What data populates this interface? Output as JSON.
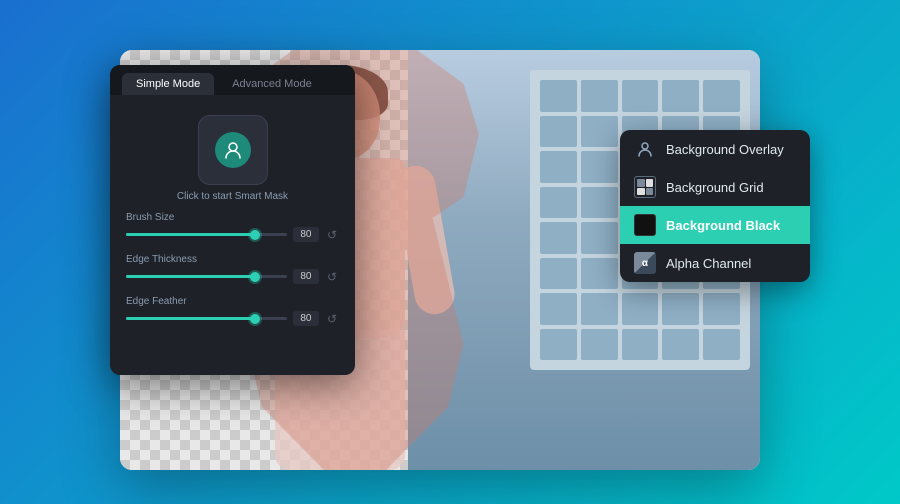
{
  "background": {
    "gradient_start": "#1a6fcf",
    "gradient_end": "#00c9c8"
  },
  "panel": {
    "tabs": [
      {
        "id": "simple",
        "label": "Simple Mode",
        "active": true
      },
      {
        "id": "advanced",
        "label": "Advanced Mode",
        "active": false
      }
    ],
    "smart_mask_label": "Click to start Smart Mask",
    "sliders": [
      {
        "label": "Brush Size",
        "value": 80,
        "percent": 80
      },
      {
        "label": "Edge Thickness",
        "value": 80,
        "percent": 80
      },
      {
        "label": "Edge Feather",
        "value": 80,
        "percent": 80
      }
    ]
  },
  "dropdown": {
    "items": [
      {
        "id": "overlay",
        "label": "Background Overlay",
        "icon_type": "person",
        "selected": false
      },
      {
        "id": "grid",
        "label": "Background Grid",
        "icon_type": "grid",
        "selected": false
      },
      {
        "id": "black",
        "label": "Background Black",
        "icon_type": "black",
        "selected": true
      },
      {
        "id": "alpha",
        "label": "Alpha Channel",
        "icon_type": "alpha",
        "selected": false
      }
    ]
  }
}
